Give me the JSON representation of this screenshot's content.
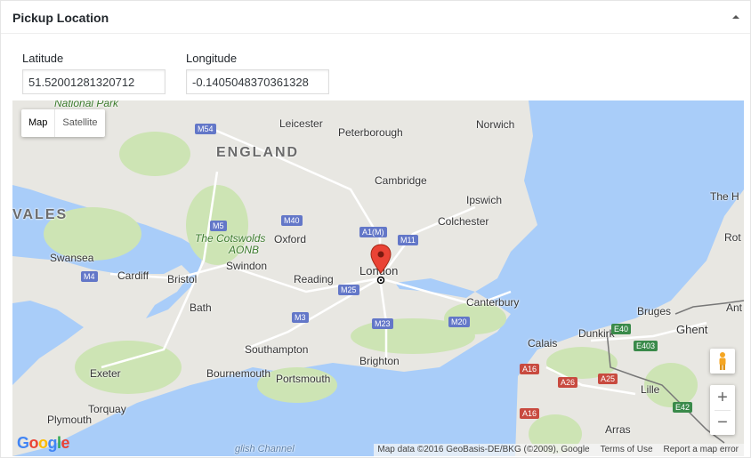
{
  "panel": {
    "title": "Pickup Location"
  },
  "fields": {
    "latitude": {
      "label": "Latitude",
      "value": "51.52001281320712"
    },
    "longitude": {
      "label": "Longitude",
      "value": "-0.1405048370361328"
    }
  },
  "map": {
    "type_buttons": {
      "map": "Map",
      "satellite": "Satellite"
    },
    "zoom": {
      "in": "+",
      "out": "−"
    },
    "logo": "Google",
    "attribution": {
      "data": "Map data ©2016 GeoBasis-DE/BKG (©2009), Google",
      "terms": "Terms of Use",
      "report": "Report a map error"
    },
    "labels": {
      "england": "ENGLAND",
      "wales": "VALES",
      "national_park": "National Park",
      "leicester": "Leicester",
      "peterborough": "Peterborough",
      "norwich": "Norwich",
      "cambridge": "Cambridge",
      "ipswich": "Ipswich",
      "colchester": "Colchester",
      "cotswolds": "The Cotswolds",
      "aonb": "AONB",
      "oxford": "Oxford",
      "swansea": "Swansea",
      "cardiff": "Cardiff",
      "bristol": "Bristol",
      "swindon": "Swindon",
      "reading": "Reading",
      "london": "London",
      "bath": "Bath",
      "canterbury": "Canterbury",
      "southampton": "Southampton",
      "brighton": "Brighton",
      "exeter": "Exeter",
      "bournemouth": "Bournemouth",
      "portsmouth": "Portsmouth",
      "plymouth": "Plymouth",
      "torquay": "Torquay",
      "calais": "Calais",
      "dunkirk": "Dunkirk",
      "bruges": "Bruges",
      "ghent": "Ghent",
      "lille": "Lille",
      "arras": "Arras",
      "the_h": "The H",
      "rot": "Rot",
      "ant": "Ant",
      "channel": "glish Channel"
    },
    "shields": {
      "m54": "M54",
      "m5": "M5",
      "m40": "M40",
      "a1m": "A1(M)",
      "m11": "M11",
      "m4": "M4",
      "m25": "M25",
      "m3": "M3",
      "m23": "M23",
      "m20": "M20",
      "a1": "A1(M)",
      "a16": "A16",
      "a26": "A26",
      "a25": "A25",
      "e40": "E40",
      "e403": "E403",
      "e42": "E42",
      "a16b": "A16"
    }
  }
}
